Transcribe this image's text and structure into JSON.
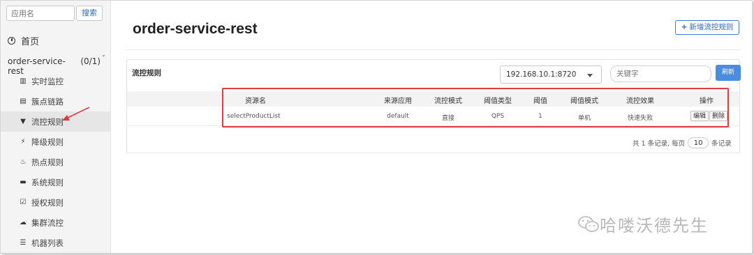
{
  "sidebar": {
    "search_placeholder": "应用名",
    "search_button": "搜索",
    "home_label": "首页",
    "app_name": "order-service-rest",
    "app_count": "(0/1)",
    "items": [
      {
        "label": "实时监控",
        "icon": "bar-chart-icon",
        "glyph": "▥"
      },
      {
        "label": "簇点链路",
        "icon": "list-icon",
        "glyph": "▤"
      },
      {
        "label": "流控规则",
        "icon": "filter-icon",
        "glyph": "▼"
      },
      {
        "label": "降级规则",
        "icon": "bolt-icon",
        "glyph": "⚡"
      },
      {
        "label": "热点规则",
        "icon": "fire-icon",
        "glyph": "♨"
      },
      {
        "label": "系统规则",
        "icon": "lock-icon",
        "glyph": "▬"
      },
      {
        "label": "授权规则",
        "icon": "check-square-icon",
        "glyph": "☑"
      },
      {
        "label": "集群流控",
        "icon": "cloud-icon",
        "glyph": "☁"
      },
      {
        "label": "机器列表",
        "icon": "th-list-icon",
        "glyph": "☰"
      }
    ]
  },
  "main": {
    "title": "order-service-rest",
    "add_button": "新增流控规则",
    "panel_title": "流控规则",
    "machine_select": "192.168.10.1:8720",
    "keyword_placeholder": "关键字",
    "refresh_button": "刷新",
    "columns": [
      "资源名",
      "来源应用",
      "流控模式",
      "阈值类型",
      "阈值",
      "阈值模式",
      "流控效果",
      "操作"
    ],
    "rows": [
      {
        "resource": "selectProductList",
        "source": "default",
        "mode": "直接",
        "threshold_type": "QPS",
        "threshold": "1",
        "threshold_mode": "单机",
        "effect": "快速失败",
        "edit": "编辑",
        "delete": "删除"
      }
    ],
    "pager_prefix": "共 1 条记录, 每页",
    "page_size": "10",
    "pager_suffix": "条记录"
  },
  "watermark": "哈喽沃德先生",
  "colors": {
    "accent": "#3a7bd5",
    "refresh_bg": "#4a8ce0",
    "highlight": "#e0393e"
  }
}
